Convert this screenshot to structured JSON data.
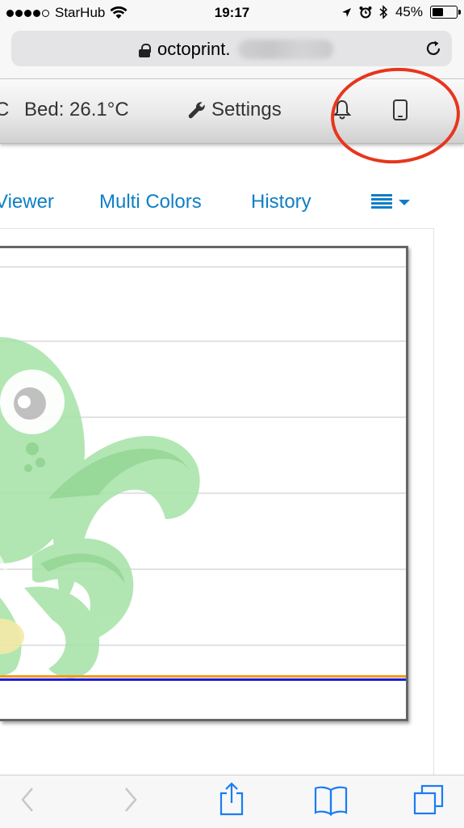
{
  "status_bar": {
    "carrier": "StarHub",
    "time": "19:17",
    "battery": "45%",
    "battery_level": 0.45
  },
  "url_bar": {
    "domain": "octoprint."
  },
  "navbar": {
    "cut_text": "C",
    "bed_temp": "Bed: 26.1°C",
    "settings_label": "Settings"
  },
  "tabs": {
    "items": [
      {
        "label": "Viewer"
      },
      {
        "label": "Multi Colors"
      },
      {
        "label": "History"
      }
    ]
  },
  "colors": {
    "link_blue": "#0e7fc7",
    "annotation_red": "#e8351e",
    "octopus_green": "#6fcf72",
    "line_orange": "#f39a1f",
    "line_blue": "#1b1bd4",
    "line_purple": "#6b58c9"
  },
  "icons": {
    "navbar": [
      "wrench-icon",
      "bell-icon",
      "phone-icon"
    ],
    "toolbar": [
      "back-icon",
      "forward-icon",
      "share-icon",
      "bookmarks-icon",
      "tabs-icon"
    ]
  }
}
